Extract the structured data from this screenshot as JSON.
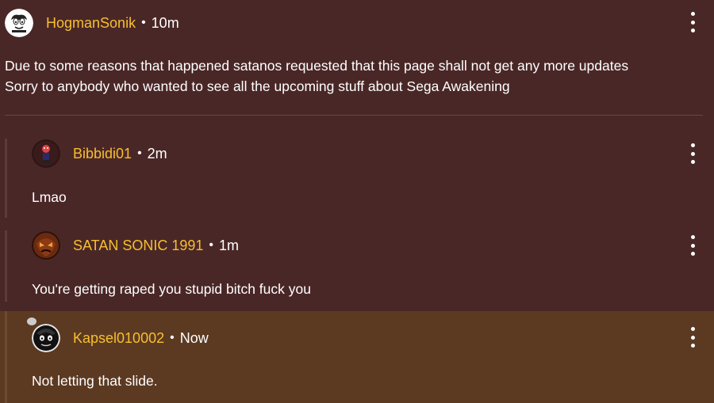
{
  "post": {
    "username": "HogmanSonik",
    "separator": "•",
    "time": "10m",
    "avatar_icon": "sonic-face-avatar-icon",
    "text_line_1": "Due to some reasons that happened satanos requested that this page shall not get any more updates",
    "text_line_2": "Sorry to anybody who wanted to see all the upcoming stuff about Sega Awakening",
    "menu_icon": "more-options-icon"
  },
  "replies": [
    {
      "username": "Bibbidi01",
      "separator": "•",
      "time": "2m",
      "text": "Lmao",
      "avatar_icon": "bibbidi-avatar-icon"
    },
    {
      "username": "SATAN SONIC 1991",
      "separator": "•",
      "time": "1m",
      "text": "You're getting raped you stupid bitch fuck you",
      "avatar_icon": "satan-sonic-avatar-icon"
    },
    {
      "username": "Kapsel010002",
      "separator": "•",
      "time": "Now",
      "text": "Not letting that slide.",
      "avatar_icon": "kapsel-avatar-icon"
    }
  ],
  "colors": {
    "background": "#4a2727",
    "highlight": "#5c3a22",
    "username": "#f7bf2f",
    "text": "#ffffff"
  }
}
